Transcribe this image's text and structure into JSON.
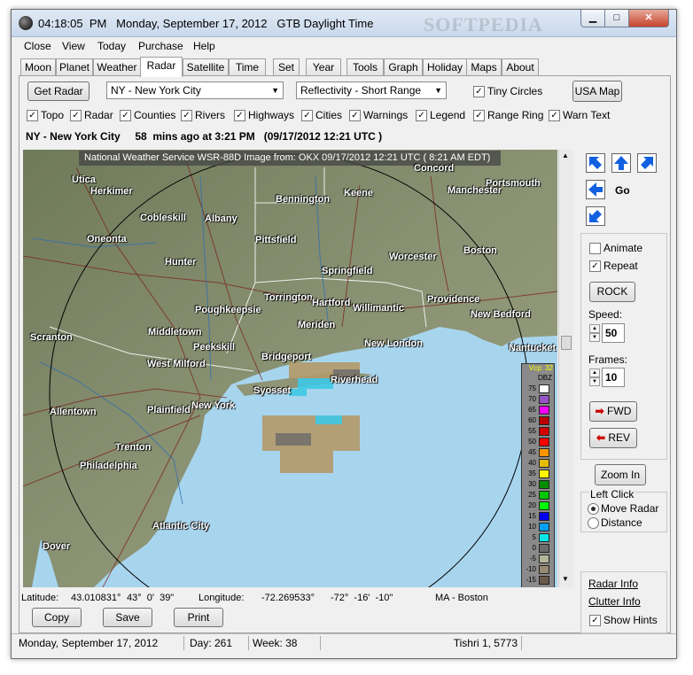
{
  "window": {
    "clock": "04:18:05  PM",
    "date": "Monday, September 17, 2012",
    "tz": "GTB Daylight Time",
    "watermark": "SOFTPEDIA"
  },
  "menu": [
    "Close",
    "View",
    "Today",
    "Purchase",
    "Help"
  ],
  "tabs": [
    "Moon",
    "Planet",
    "Weather",
    "Radar",
    "Satellite",
    "Time",
    "Set",
    "Year",
    "Tools",
    "Graph",
    "Holiday",
    "Maps",
    "About"
  ],
  "active_tab": "Radar",
  "controls": {
    "get_radar": "Get Radar",
    "station": "NY - New York City",
    "product": "Reflectivity - Short Range",
    "tiny_circles": "Tiny Circles",
    "usa_map": "USA Map"
  },
  "layers": [
    {
      "label": "Topo",
      "checked": true
    },
    {
      "label": "Radar",
      "checked": true
    },
    {
      "label": "Counties",
      "checked": true
    },
    {
      "label": "Rivers",
      "checked": true
    },
    {
      "label": "Highways",
      "checked": true
    },
    {
      "label": "Cities",
      "checked": true
    },
    {
      "label": "Warnings",
      "checked": true
    },
    {
      "label": "Legend",
      "checked": true
    },
    {
      "label": "Range Ring",
      "checked": true
    },
    {
      "label": "Warn Text",
      "checked": true
    }
  ],
  "station_line": "NY - New York City     58  mins ago at 3:21 PM   (09/17/2012 12:21 UTC )",
  "map": {
    "caption": "National Weather Service WSR-88D Image  from:  OKX  09/17/2012 12:21  UTC ( 8:21  AM EDT)",
    "cities": [
      "Utica",
      "Herkimer",
      "Cobleskill",
      "Albany",
      "Oneonta",
      "Hunter",
      "Bennington",
      "Keene",
      "Manchester",
      "Portsmouth",
      "Concord",
      "Pittsfield",
      "Springfield",
      "Worcester",
      "Boston",
      "Poughkeepsie",
      "Torrington",
      "Hartford",
      "Willimantic",
      "Providence",
      "New Bedford",
      "Middletown",
      "Meriden",
      "New London",
      "Nantucket",
      "Scranton",
      "Peekskill",
      "West Milford",
      "Bridgeport",
      "Riverhead",
      "Syosset",
      "Allentown",
      "Plainfield",
      "New York",
      "Trenton",
      "Philadelphia",
      "Atlantic City",
      "Dover"
    ],
    "legend_vcp": "Vcp: 32",
    "legend_unit": "DBZ",
    "legend": [
      {
        "v": "75",
        "c": "#ffffff"
      },
      {
        "v": "70",
        "c": "#9854c6"
      },
      {
        "v": "65",
        "c": "#f800fd"
      },
      {
        "v": "60",
        "c": "#bc0000"
      },
      {
        "v": "55",
        "c": "#d40000"
      },
      {
        "v": "50",
        "c": "#fd0000"
      },
      {
        "v": "45",
        "c": "#fd9500"
      },
      {
        "v": "40",
        "c": "#e5bc00"
      },
      {
        "v": "35",
        "c": "#fdf802"
      },
      {
        "v": "30",
        "c": "#008e00"
      },
      {
        "v": "25",
        "c": "#01c501"
      },
      {
        "v": "20",
        "c": "#02fd02"
      },
      {
        "v": "15",
        "c": "#0300f4"
      },
      {
        "v": "10",
        "c": "#019ff4"
      },
      {
        "v": "5",
        "c": "#04e9e7"
      },
      {
        "v": "0",
        "c": "#6b6b6b"
      },
      {
        "v": "-5",
        "c": "#b4b49a"
      },
      {
        "v": "-10",
        "c": "#958a71"
      },
      {
        "v": "-15",
        "c": "#6c5a4a"
      }
    ]
  },
  "right": {
    "go": "Go",
    "animate": "Animate",
    "repeat": "Repeat",
    "rock": "ROCK",
    "speed_label": "Speed:",
    "speed": "50",
    "frames_label": "Frames:",
    "frames": "10",
    "fwd": "FWD",
    "rev": "REV",
    "zoom_in": "Zoom In",
    "left_click": "Left Click",
    "move_radar": "Move Radar",
    "distance": "Distance",
    "radar_info": "Radar Info",
    "clutter_info": "Clutter Info",
    "show_hints": "Show Hints"
  },
  "coords": {
    "lat_label": "Latitude:",
    "lat": "43.010831°",
    "lat_dms": "43°  0'  39\"",
    "lon_label": "Longitude:",
    "lon": "-72.269533°",
    "lon_dms": "-72°  -16'  -10\"",
    "nearest": "MA - Boston"
  },
  "buttons": {
    "copy": "Copy",
    "save": "Save",
    "print": "Print"
  },
  "status": {
    "date": "Monday, September 17, 2012",
    "day": "Day: 261",
    "week": "Week: 38",
    "hebrew": "Tishri 1, 5773"
  }
}
